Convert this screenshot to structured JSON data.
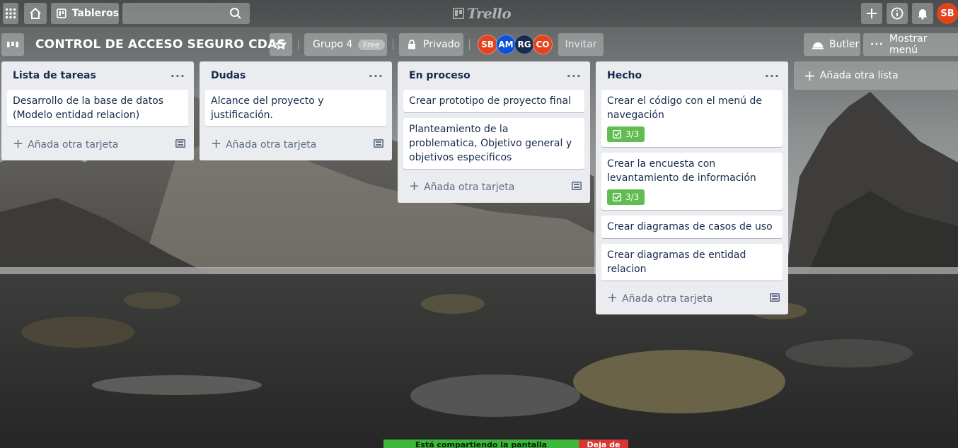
{
  "topbar": {
    "boards_label": "Tableros",
    "search_placeholder": "",
    "logo_text": "Trello",
    "user_initials": "SB",
    "user_color": "#e2431d"
  },
  "board": {
    "title": "CONTROL DE ACCESO SEGURO CDAS",
    "team_label": "Grupo 4",
    "team_badge": "Free",
    "visibility_label": "Privado",
    "invite_label": "Invitar",
    "butler_label": "Butler",
    "menu_label": "Mostrar menú",
    "members": [
      {
        "initials": "SB",
        "color": "#e2431d"
      },
      {
        "initials": "AM",
        "color": "#0b52d9"
      },
      {
        "initials": "RG",
        "color": "#172b4d"
      },
      {
        "initials": "CO",
        "color": "#e2431d"
      }
    ]
  },
  "lists": [
    {
      "title": "Lista de tareas",
      "cards": [
        {
          "text": "Desarrollo de la base de datos (Modelo entidad relacion)"
        }
      ],
      "add_card_label": "Añada otra tarjeta"
    },
    {
      "title": "Dudas",
      "cards": [
        {
          "text": "Alcance del proyecto y justificación."
        }
      ],
      "add_card_label": "Añada otra tarjeta"
    },
    {
      "title": "En proceso",
      "cards": [
        {
          "text": "Crear prototipo de proyecto final"
        },
        {
          "text": "Planteamiento de la problematica, Objetivo general y objetivos especificos"
        }
      ],
      "add_card_label": "Añada otra tarjeta"
    },
    {
      "title": "Hecho",
      "cards": [
        {
          "text": "Crear el código con el menú de navegación",
          "checklist": "3/3"
        },
        {
          "text": "Crear la encuesta con levantamiento de información",
          "checklist": "3/3"
        },
        {
          "text": "Crear diagramas de casos de uso"
        },
        {
          "text": "Crear diagramas de entidad relacion"
        }
      ],
      "add_card_label": "Añada otra tarjeta"
    }
  ],
  "add_list_label": "Añada otra lista",
  "screenshare": {
    "message": "Está compartiendo la pantalla",
    "stop_label": "Deja de"
  }
}
